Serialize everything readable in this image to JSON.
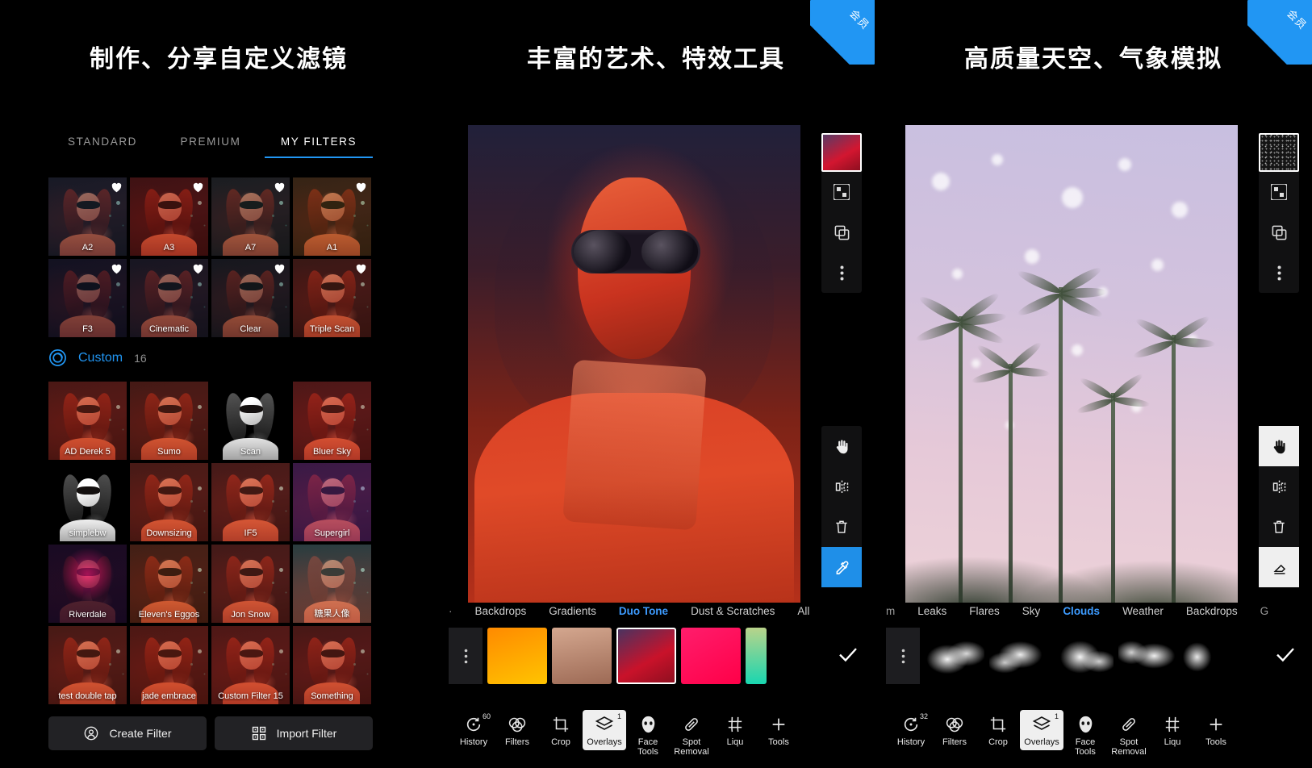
{
  "panels": [
    {
      "title": "制作、分享自定义滤镜",
      "vip_badge": null,
      "filter_tabs": [
        {
          "label": "STANDARD",
          "active": false
        },
        {
          "label": "PREMIUM",
          "active": false
        },
        {
          "label": "MY FILTERS",
          "active": true
        }
      ],
      "favourite_rows": [
        [
          {
            "name": "A2",
            "favourite": true
          },
          {
            "name": "A3",
            "favourite": true
          },
          {
            "name": "A7",
            "favourite": true
          },
          {
            "name": "A1",
            "favourite": true
          }
        ],
        [
          {
            "name": "F3",
            "favourite": true
          },
          {
            "name": "Cinematic",
            "favourite": true
          },
          {
            "name": "Clear",
            "favourite": true
          },
          {
            "name": "Triple Scan",
            "favourite": true
          }
        ]
      ],
      "custom_section": {
        "icon": "custom-filter-icon",
        "label": "Custom",
        "count": "16"
      },
      "custom_rows": [
        [
          {
            "name": "AD Derek 5"
          },
          {
            "name": "Sumo"
          },
          {
            "name": "Scan"
          },
          {
            "name": "Bluer Sky"
          }
        ],
        [
          {
            "name": "simplebw"
          },
          {
            "name": "Downsizing"
          },
          {
            "name": "IF5"
          },
          {
            "name": "Supergirl"
          }
        ],
        [
          {
            "name": "Riverdale"
          },
          {
            "name": "Eleven's Eggos"
          },
          {
            "name": "Jon Snow"
          },
          {
            "name": "糖果人像"
          }
        ],
        [
          {
            "name": "test double tap"
          },
          {
            "name": "jade embrace"
          },
          {
            "name": "Custom Filter 15"
          },
          {
            "name": "Something"
          }
        ]
      ],
      "actions": [
        {
          "label": "Create Filter",
          "icon": "create-filter-icon"
        },
        {
          "label": "Import Filter",
          "icon": "qr-import-icon"
        }
      ]
    },
    {
      "title": "丰富的艺术、特效工具",
      "vip_badge": "会员",
      "right_tools_top": [
        {
          "icon": "gradient-swatch",
          "selected": true
        },
        {
          "icon": "checkerboard-icon",
          "selected": false
        },
        {
          "icon": "duplicate-layer-icon",
          "selected": false
        },
        {
          "icon": "more-kebab-icon",
          "selected": false
        }
      ],
      "right_tools_bottom": [
        {
          "icon": "hand-icon",
          "selected": false
        },
        {
          "icon": "mirror-icon",
          "selected": false
        },
        {
          "icon": "trash-icon",
          "selected": false
        },
        {
          "icon": "eyedropper-icon",
          "selected": true
        }
      ],
      "categories": [
        {
          "label": "·",
          "active": false,
          "clipped": true
        },
        {
          "label": "Backdrops",
          "active": false
        },
        {
          "label": "Gradients",
          "active": false
        },
        {
          "label": "Duo Tone",
          "active": true
        },
        {
          "label": "Dust & Scratches",
          "active": false
        },
        {
          "label": "All",
          "active": false
        }
      ],
      "swatches": [
        {
          "name": "more-kebab",
          "color": "#1d1d20",
          "selected": false,
          "kebab": true
        },
        {
          "name": "orange-gradient",
          "color": "linear-gradient(160deg,#ff8a00,#ffc400)",
          "selected": false
        },
        {
          "name": "tan-gradient",
          "color": "linear-gradient(170deg,#cfa189,#9d6a55)",
          "selected": false
        },
        {
          "name": "red-duotone",
          "color": "linear-gradient(150deg,#4a3360,#c9122a 60%,#8e0f20)",
          "selected": true
        },
        {
          "name": "pink-gradient",
          "color": "linear-gradient(150deg,#ff1d6c,#ff0048)",
          "selected": false
        },
        {
          "name": "teal-gradient",
          "color": "linear-gradient(180deg,#b9d38a,#19d6b0)",
          "selected": false
        }
      ],
      "confirm_icon": "check-icon",
      "toolbar": [
        {
          "label": "History",
          "icon": "history-icon",
          "badge": "60",
          "selected": false
        },
        {
          "label": "Filters",
          "icon": "filters-icon",
          "badge": null,
          "selected": false
        },
        {
          "label": "Crop",
          "icon": "crop-icon",
          "badge": null,
          "selected": false
        },
        {
          "label": "Overlays",
          "icon": "overlays-icon",
          "badge": "1",
          "selected": true
        },
        {
          "label": "Face\nTools",
          "icon": "face-tools-icon",
          "badge": null,
          "selected": false
        },
        {
          "label": "Spot\nRemoval",
          "icon": "spot-removal-icon",
          "badge": null,
          "selected": false
        },
        {
          "label": "Liqu",
          "icon": "liquify-icon",
          "badge": null,
          "selected": false
        },
        {
          "label": "Tools",
          "icon": "tools-icon",
          "badge": null,
          "selected": false
        }
      ]
    },
    {
      "title": "高质量天空、气象模拟",
      "vip_badge": "会员",
      "right_tools_top": [
        {
          "icon": "noise-swatch",
          "selected": true
        },
        {
          "icon": "checkerboard-icon",
          "selected": false
        },
        {
          "icon": "duplicate-layer-icon",
          "selected": false
        },
        {
          "icon": "more-kebab-icon",
          "selected": false
        }
      ],
      "right_tools_bottom": [
        {
          "icon": "hand-icon",
          "selected": true
        },
        {
          "icon": "mirror-icon",
          "selected": false
        },
        {
          "icon": "trash-icon",
          "selected": false
        },
        {
          "icon": "eraser-icon",
          "selected": false
        }
      ],
      "categories": [
        {
          "label": "m",
          "active": false,
          "clipped": true
        },
        {
          "label": "Leaks",
          "active": false
        },
        {
          "label": "Flares",
          "active": false
        },
        {
          "label": "Sky",
          "active": false
        },
        {
          "label": "Clouds",
          "active": true
        },
        {
          "label": "Weather",
          "active": false
        },
        {
          "label": "Backdrops",
          "active": false
        },
        {
          "label": "G",
          "active": false,
          "clipped": true
        }
      ],
      "swatches": [
        {
          "name": "more-kebab",
          "color": "#1d1d20",
          "selected": false,
          "kebab": true
        },
        {
          "name": "cloud-1",
          "color": "",
          "selected": false,
          "cloud": true
        },
        {
          "name": "cloud-2",
          "color": "",
          "selected": false,
          "cloud": true
        },
        {
          "name": "cloud-3",
          "color": "",
          "selected": false,
          "cloud": true
        },
        {
          "name": "cloud-4",
          "color": "",
          "selected": false,
          "cloud": true
        },
        {
          "name": "cloud-5",
          "color": "",
          "selected": false,
          "cloud": true
        }
      ],
      "confirm_icon": "check-icon",
      "toolbar": [
        {
          "label": "History",
          "icon": "history-icon",
          "badge": "32",
          "selected": false
        },
        {
          "label": "Filters",
          "icon": "filters-icon",
          "badge": null,
          "selected": false
        },
        {
          "label": "Crop",
          "icon": "crop-icon",
          "badge": null,
          "selected": false
        },
        {
          "label": "Overlays",
          "icon": "overlays-icon",
          "badge": "1",
          "selected": true
        },
        {
          "label": "Face\nTools",
          "icon": "face-tools-icon",
          "badge": null,
          "selected": false
        },
        {
          "label": "Spot\nRemoval",
          "icon": "spot-removal-icon",
          "badge": null,
          "selected": false
        },
        {
          "label": "Liqu",
          "icon": "liquify-icon",
          "badge": null,
          "selected": false
        },
        {
          "label": "Tools",
          "icon": "tools-icon",
          "badge": null,
          "selected": false
        }
      ]
    }
  ],
  "colors": {
    "accent_blue": "#2196f3",
    "active_tab_blue": "#3d9bff",
    "background": "#000000",
    "button_bg": "#222225",
    "selected_tool_bg": "#efefef"
  }
}
